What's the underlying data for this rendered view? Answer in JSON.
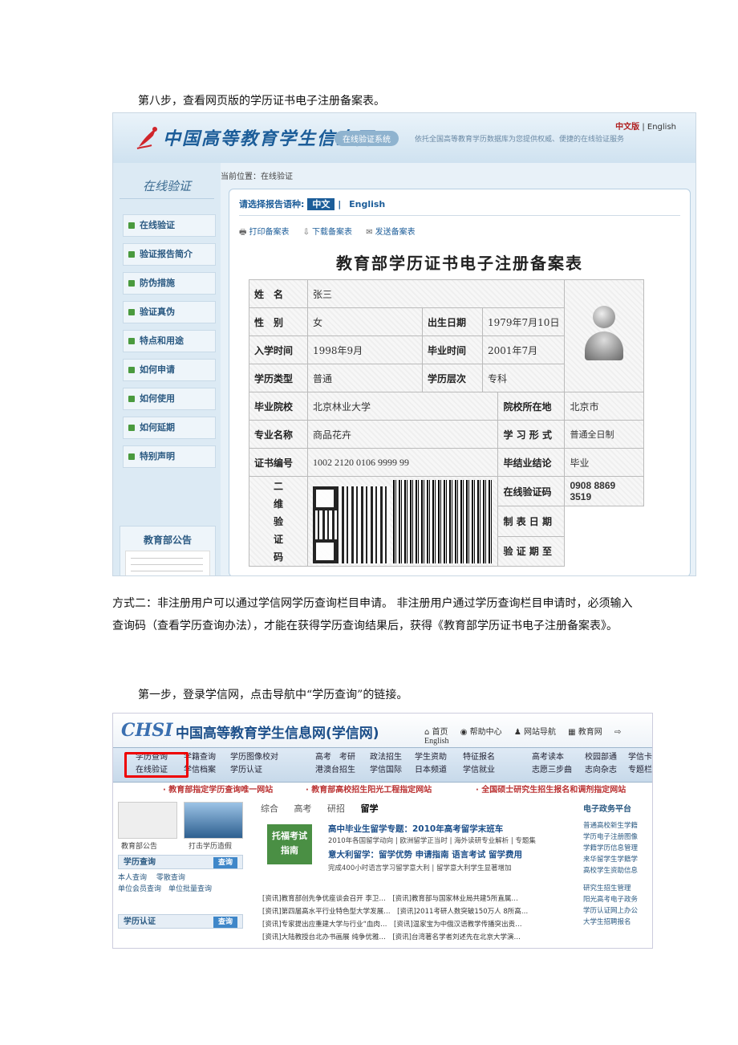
{
  "doc": {
    "step8": "第八步，查看网页版的学历证书电子注册备案表。",
    "method2": "方式二：非注册用户可以通过学信网学历查询栏目申请。 非注册用户通过学历查询栏目申请时，必须输入查询码（查看学历查询办法），才能在获得学历查询结果后，获得《教育部学历证书电子注册备案表》。",
    "step1": "第一步，登录学信网，点击导航中“学历查询”的链接。"
  },
  "shot1": {
    "logo_text": "中国高等教育学生信息网",
    "pill": "在线验证系统",
    "slogan": "依托全国高等教育学历数据库为您提供权威、便捷的在线验证服务",
    "lang_zh": "中文版",
    "lang_en": "| English",
    "side_title": "在线验证",
    "menu": [
      "在线验证",
      "验证报告简介",
      "防伪措施",
      "验证真伪",
      "特点和用途",
      "如何申请",
      "如何使用",
      "如何延期",
      "特别声明"
    ],
    "notice_title": "教育部公告",
    "crumb": "当前位置：在线验证",
    "select_label": "请选择报告语种:",
    "select_zh": "中文",
    "select_sep": "|",
    "select_en": "English",
    "actions": [
      "打印备案表",
      "下载备案表",
      "发送备案表"
    ],
    "title": "教育部学历证书电子注册备案表",
    "fields": {
      "name_k": "姓　名",
      "name_v": "张三",
      "gender_k": "性　别",
      "gender_v": "女",
      "birth_k": "出生日期",
      "birth_v": "1979年7月10日",
      "enroll_k": "入学时间",
      "enroll_v": "1998年9月",
      "grad_k": "毕业时间",
      "grad_v": "2001年7月",
      "type_k": "学历类型",
      "type_v": "普通",
      "level_k": "学历层次",
      "level_v": "专科",
      "school_k": "毕业院校",
      "school_v": "北京林业大学",
      "loc_k": "院校所在地",
      "loc_v": "北京市",
      "major_k": "专业名称",
      "major_v": "商品花卉",
      "form_k": "学 习 形 式",
      "form_v": "普通全日制",
      "cert_k": "证书编号",
      "cert_v": "1002 2120 0106 9999 99",
      "result_k": "毕结业结论",
      "result_v": "毕业",
      "qr_k": "二\n维\n验\n证\n码",
      "verify_k": "在线验证码",
      "verify_v": "0908 8869 3519",
      "made_k": "制 表 日 期",
      "valid_k": "验 证 期 至"
    }
  },
  "shot2": {
    "logo": "CHSI",
    "site": "中国高等教育学生信息网(学信网)",
    "top_links": [
      "首页",
      "帮助中心",
      "网站导航",
      "教育网",
      "English"
    ],
    "nav": [
      {
        "l1": "学历查询",
        "l2": "在线验证"
      },
      {
        "l1": "学籍查询",
        "l2": "学信档案"
      },
      {
        "l1": "学历图像校对",
        "l2": "学历认证"
      },
      {
        "l1": "高考　考研",
        "l2": "港澳台招生"
      },
      {
        "l1": "政法招生",
        "l2": "学信国际"
      },
      {
        "l1": "学生资助",
        "l2": "日本频道"
      },
      {
        "l1": "特征报名",
        "l2": "学信就业"
      },
      {
        "l1": "高考读本",
        "l2": "志愿三步曲"
      },
      {
        "l1": "校园部通",
        "l2": "志向杂志"
      },
      {
        "l1": "学信卡",
        "l2": "专题栏"
      }
    ],
    "banner": [
      "· 教育部指定学历查询唯一网站",
      "· 教育部高校招生阳光工程指定网站",
      "· 全国硕士研究生招生报名和调剂指定网站"
    ],
    "left": {
      "cap1": "教育部公告",
      "cap2": "打击学历造假",
      "box1": "学历查询",
      "box_btn": "查询",
      "links1": "本人查询　 零散查询\n单位会员查询　单位批量查询",
      "box2": "学历认证"
    },
    "center": {
      "tabs": [
        "综合",
        "高考",
        "研招",
        "留学"
      ],
      "toefl": "托福考试\n指南",
      "h1": "高中毕业生留学专题：2010年高考留学末班车",
      "s1": "2010年各国留学动向 | 欧洲留学正当时 | 海外读研专业解析 | 专题集",
      "h2": "意大利留学：留学优势 申请指南 语言考试 留学费用",
      "s2": "完成400小时语言学习留学意大利 | 留学意大利学生显著增加",
      "news": [
        "[资讯]教育部创先争优座谈会召开 李卫…　[资讯]教育部与国家林业局共建5所直属…",
        "[资讯]第四届高水平行业特色型大学发展…　[资讯]2011考研人数突破150万人 8所高…",
        "[资讯]专家提出应重建大学与行业“血肉…　[资讯]温家宝为中俄汉语教学传播突出贡…",
        "[资讯]大陆教授台北办书画展 纯争优雅…　[资讯]台湾著名学者刘述先在北京大学演…"
      ]
    },
    "right": {
      "title": "电子政务平台",
      "links": [
        "普通高校新生学籍",
        "学历电子注册图像",
        "学籍学历信息管理",
        "来华留学生学籍学",
        "高校学生资助信息",
        "研究生招生管理",
        "阳光高考电子政务",
        "学历认证网上办公",
        "大学生招聘报名"
      ]
    }
  }
}
